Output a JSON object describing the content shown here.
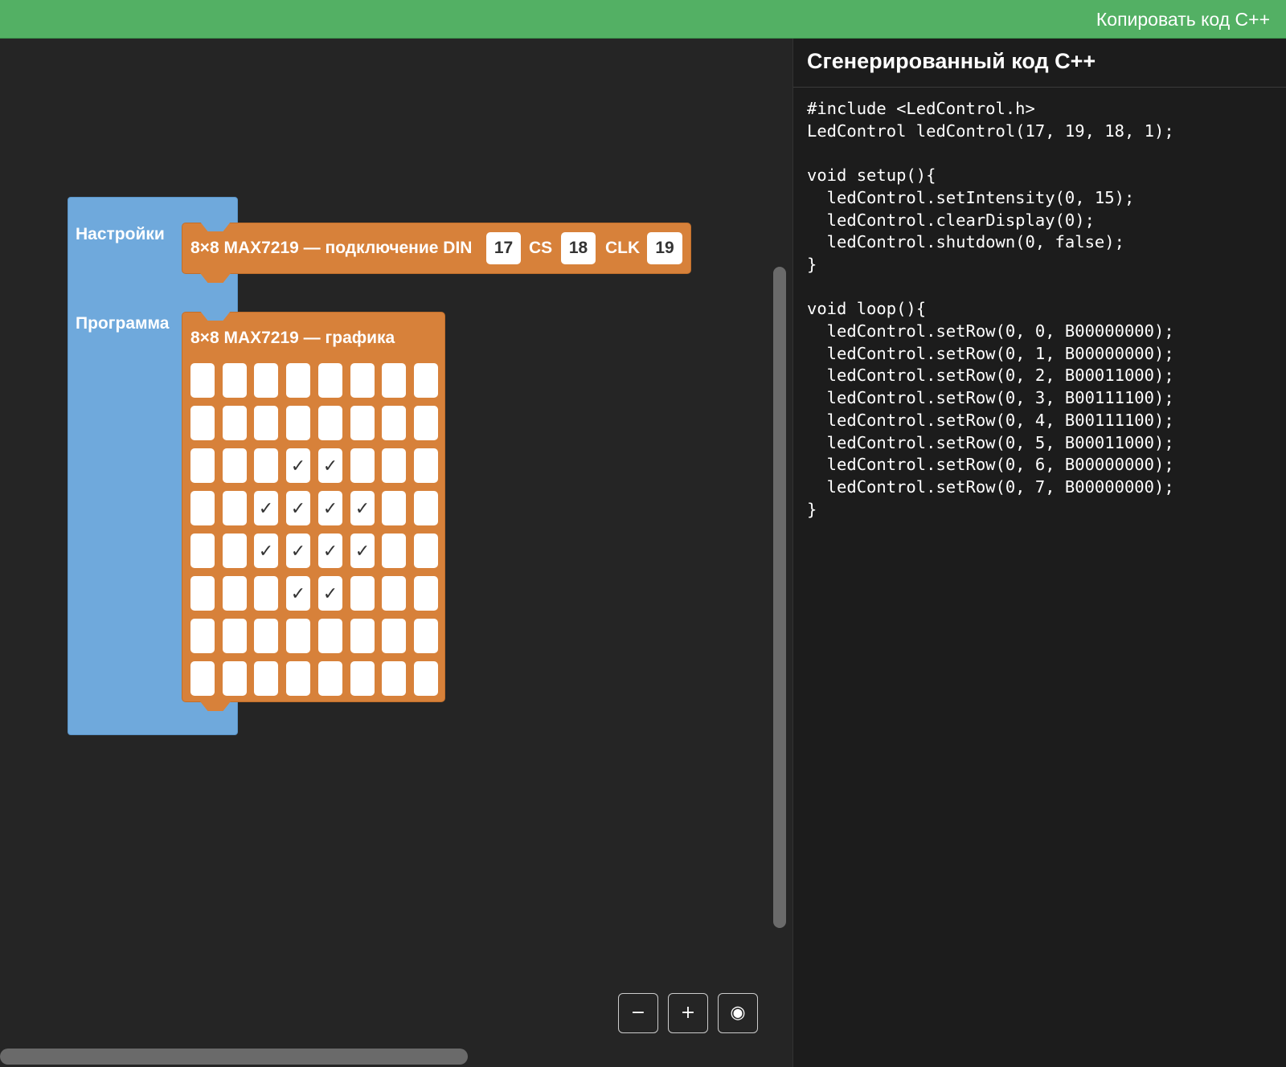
{
  "toolbar": {
    "copy_label": "Копировать код C++"
  },
  "workspace": {
    "setup_label": "Настройки",
    "program_label": "Программа",
    "connection_block": {
      "title": "8×8 MAX7219 — подключение DIN",
      "din": "17",
      "cs_label": "CS",
      "cs": "18",
      "clk_label": "CLK",
      "clk": "19"
    },
    "graphics_block": {
      "title": "8×8 MAX7219 — графика",
      "check_glyph": "✓",
      "matrix": [
        [
          0,
          0,
          0,
          0,
          0,
          0,
          0,
          0
        ],
        [
          0,
          0,
          0,
          0,
          0,
          0,
          0,
          0
        ],
        [
          0,
          0,
          0,
          1,
          1,
          0,
          0,
          0
        ],
        [
          0,
          0,
          1,
          1,
          1,
          1,
          0,
          0
        ],
        [
          0,
          0,
          1,
          1,
          1,
          1,
          0,
          0
        ],
        [
          0,
          0,
          0,
          1,
          1,
          0,
          0,
          0
        ],
        [
          0,
          0,
          0,
          0,
          0,
          0,
          0,
          0
        ],
        [
          0,
          0,
          0,
          0,
          0,
          0,
          0,
          0
        ]
      ]
    },
    "zoom": {
      "zoom_out": "−",
      "zoom_in": "+",
      "reset": "◉"
    }
  },
  "code_panel": {
    "title": "Сгенерированный код C++",
    "code": "#include <LedControl.h>\nLedControl ledControl(17, 19, 18, 1);\n\nvoid setup(){\n  ledControl.setIntensity(0, 15);\n  ledControl.clearDisplay(0);\n  ledControl.shutdown(0, false);\n}\n\nvoid loop(){\n  ledControl.setRow(0, 0, B00000000);\n  ledControl.setRow(0, 1, B00000000);\n  ledControl.setRow(0, 2, B00011000);\n  ledControl.setRow(0, 3, B00111100);\n  ledControl.setRow(0, 4, B00111100);\n  ledControl.setRow(0, 5, B00011000);\n  ledControl.setRow(0, 6, B00000000);\n  ledControl.setRow(0, 7, B00000000);\n}"
  },
  "colors": {
    "toolbar_green": "#53b064",
    "block_blue": "#6fa9dc",
    "block_orange": "#d7813a",
    "workspace_bg": "#252525",
    "code_bg": "#1c1c1c"
  }
}
